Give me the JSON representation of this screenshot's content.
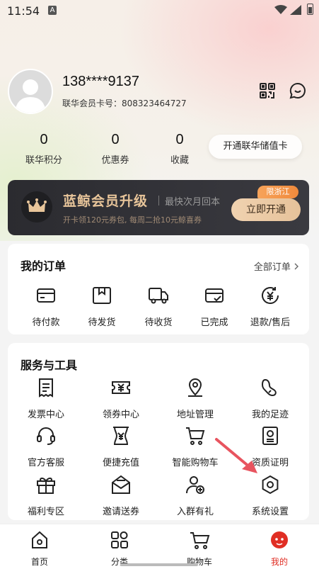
{
  "status_bar": {
    "time": "11:54",
    "a_badge": "A"
  },
  "profile": {
    "phone": "138****9137",
    "card_label": "联华会员卡号：",
    "card_number": "808323464727"
  },
  "stats": [
    {
      "value": "0",
      "label": "联华积分"
    },
    {
      "value": "0",
      "label": "优惠券"
    },
    {
      "value": "0",
      "label": "收藏"
    }
  ],
  "stored_value_button": "开通联华储值卡",
  "vip_banner": {
    "title": "蓝鲸会员升级",
    "subtitle": "最快次月回本",
    "description": "开卡领120元券包, 每周二抢10元鲸喜券",
    "badge": "限浙江",
    "button": "立即开通",
    "accent_color": "#e8c59a"
  },
  "orders": {
    "title": "我的订单",
    "all_link": "全部订单",
    "items": [
      {
        "label": "待付款",
        "icon": "wallet-icon"
      },
      {
        "label": "待发货",
        "icon": "package-icon"
      },
      {
        "label": "待收货",
        "icon": "truck-icon"
      },
      {
        "label": "已完成",
        "icon": "completed-icon"
      },
      {
        "label": "退款/售后",
        "icon": "refund-icon"
      }
    ]
  },
  "services": {
    "title": "服务与工具",
    "items": [
      {
        "label": "发票中心",
        "icon": "invoice-icon"
      },
      {
        "label": "领券中心",
        "icon": "coupon-icon"
      },
      {
        "label": "地址管理",
        "icon": "location-icon"
      },
      {
        "label": "我的足迹",
        "icon": "footprint-icon"
      },
      {
        "label": "官方客服",
        "icon": "headset-icon"
      },
      {
        "label": "便捷充值",
        "icon": "recharge-icon"
      },
      {
        "label": "智能购物车",
        "icon": "cart-icon"
      },
      {
        "label": "资质证明",
        "icon": "certificate-icon"
      },
      {
        "label": "福利专区",
        "icon": "gift-icon"
      },
      {
        "label": "邀请送券",
        "icon": "invite-mail-icon"
      },
      {
        "label": "入群有礼",
        "icon": "add-user-icon"
      },
      {
        "label": "系统设置",
        "icon": "settings-icon"
      }
    ]
  },
  "bottom_nav": [
    {
      "label": "首页",
      "icon": "home-icon"
    },
    {
      "label": "分类",
      "icon": "category-icon"
    },
    {
      "label": "购物车",
      "icon": "cart-icon"
    },
    {
      "label": "我的",
      "icon": "profile-icon",
      "active": true
    }
  ],
  "colors": {
    "active": "#e02e24",
    "annotation_arrow": "#e8545f"
  }
}
